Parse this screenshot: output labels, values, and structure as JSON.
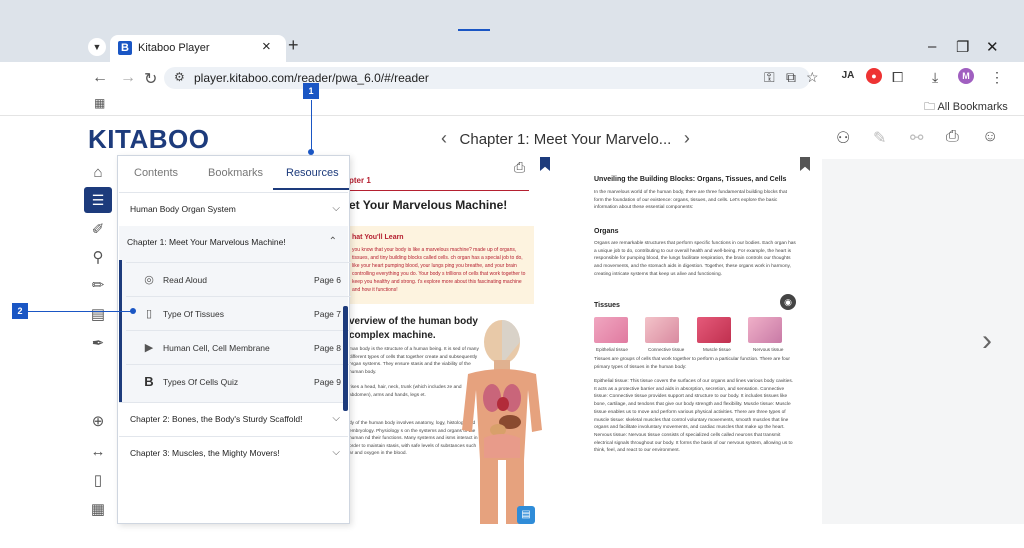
{
  "browser": {
    "tab_title": "Kitaboo Player",
    "favicon_letter": "B",
    "url": "player.kitaboo.com/reader/pwa_6.0/#/reader",
    "bookmarks_label": "All Bookmarks",
    "profile_initial": "M",
    "ext1": "JA"
  },
  "reader": {
    "logo": "KITABOO",
    "chapter_title": "Chapter 1: Meet Your Marvelo..."
  },
  "toc": {
    "tabs": [
      "Contents",
      "Bookmarks",
      "Resources"
    ],
    "active_tab": "Resources",
    "chapters": [
      {
        "label": "Human Body Organ System"
      },
      {
        "label": "Chapter 1: Meet Your Marvelous Machine!"
      },
      {
        "label": "Chapter 2: Bones, the Body's Sturdy Scaffold!"
      },
      {
        "label": "Chapter 3: Muscles, the Mighty Movers!"
      }
    ],
    "resources": [
      {
        "label": "Read Aloud",
        "page": "Page 6",
        "icon": "audio-icon"
      },
      {
        "label": "Type Of Tissues",
        "page": "Page 7",
        "icon": "document-icon"
      },
      {
        "label": "Human Cell, Cell Membrane",
        "page": "Page 8",
        "icon": "video-icon"
      },
      {
        "label": "Types Of Cells Quiz",
        "page": "Page 9",
        "icon": "quiz-icon"
      }
    ]
  },
  "callouts": {
    "one": "1",
    "two": "2"
  },
  "left_page": {
    "chapter": "pter 1",
    "heading": "et Your Marvelous Machine!",
    "learn_heading": "hat You'll Learn",
    "learn_text": "you know that your body is like a marvelous machine? made up of organs, tissues, and tiny building blocks called cells. ch organ has a special job to do, like your heart pumping blood, your lungs ping you breathe, and your brain controlling everything you do. Your body s trillions of cells that work together to keep you healthy and strong. t's explore more about this fascinating machine and how it functions!",
    "overview_heading": "verview of the human body complex machine.",
    "para1": "man body is the structure of a human being. It is sed of many different types of cells that together create and subsequently organ systems. They ensure stasis and the viability of the human body.",
    "para2": "rises a head, hair, neck, trunk (which includes ze and abdomen), arms and hands, legs et.",
    "para3": "dy of the human body involves anatomy, logy, histology and embryology. Physiology s on the systems and organs of the human nd their functions. Many systems and isms interact in order to maintain stasis, with safe levels of substances such ar and oxygen in the blood."
  },
  "right_page": {
    "heading": "Unveiling the Building Blocks: Organs, Tissues, and Cells",
    "intro": "In the marvelous world of the human body, there are three fundamental building blocks that form the foundation of our existence: organs, tissues, and cells. Let's explore the basic information about these essential components:",
    "organs_heading": "Organs",
    "organs_text": "Organs are remarkable structures that perform specific functions in our bodies. Each organ has a unique job to do, contributing to our overall health and well-being. For example, the heart is responsible for pumping blood, the lungs facilitate respiration, the brain controls our thoughts and movements, and the stomach aids in digestion. Together, these organs work in harmony, creating intricate systems that keep us alive and functioning.",
    "tissues_heading": "Tissues",
    "tissue_labels": [
      "Epithelial tissue",
      "Connective tissue",
      "Muscle tissue",
      "Nervous tissue"
    ],
    "tissues_intro": "Tissues are groups of cells that work together to perform a particular function. There are four primary types of tissues in the human body:",
    "tissue_details": "Epithelial tissue: This tissue covers the surfaces of our organs and lines various body cavities. It acts as a protective barrier and aids in absorption, secretion, and sensation. Connective tissue: Connective tissue provides support and structure to our body. It includes tissues like bone, cartilage, and tendons that give our body strength and flexibility. Muscle tissue: Muscle tissue enables us to move and perform various physical activities. There are three types of muscle tissue: skeletal muscles that control voluntary movements, smooth muscles that line organs and facilitate involuntary movements, and cardiac muscles that make up the heart. Nervous tissue: Nervous tissue consists of specialized cells called neurons that transmit electrical signals throughout our body. It forms the basis of our nervous system, allowing us to think, feel, and react to our environment."
  },
  "colors": {
    "brand": "#1d3b7c",
    "accent": "#1a56c4",
    "chapter_red": "#b52030"
  }
}
